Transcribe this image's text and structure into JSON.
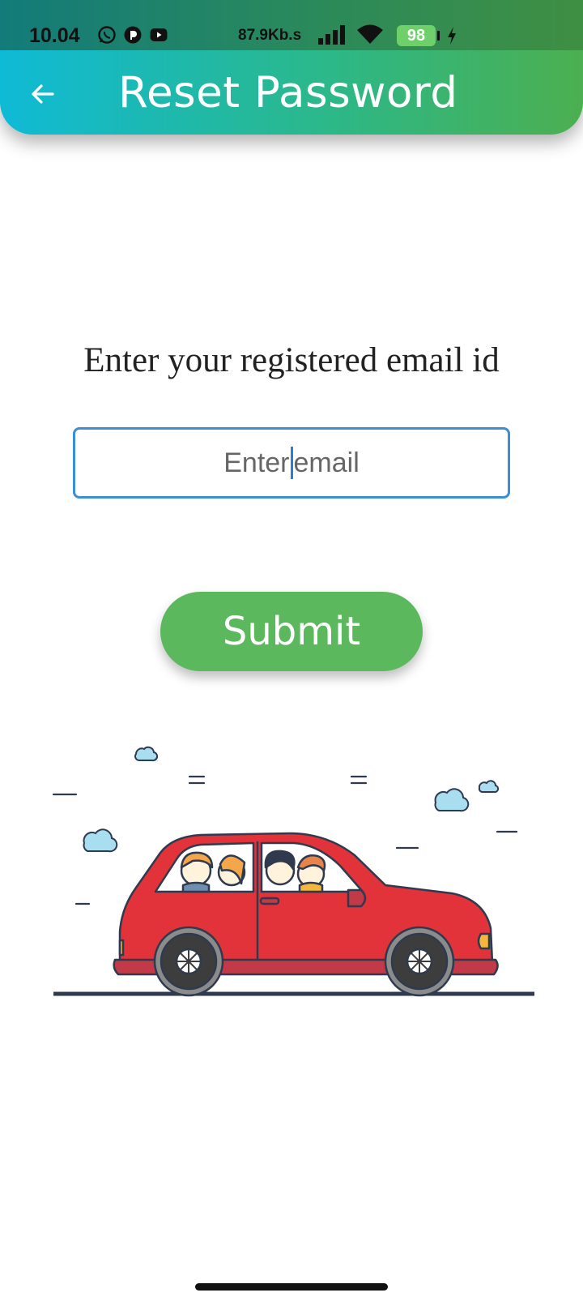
{
  "status_bar": {
    "time": "10.04",
    "network_speed": "87.9Kb.s",
    "battery": "98",
    "icons": [
      "whatsapp-icon",
      "app-icon",
      "youtube-icon",
      "signal-icon",
      "wifi-icon",
      "battery-icon",
      "charging-bolt-icon"
    ]
  },
  "header": {
    "back_icon": "back-arrow-icon",
    "title": "Reset Password"
  },
  "main": {
    "prompt": "Enter your registered email id",
    "email_input": {
      "placeholder_before_caret": "Enter",
      "placeholder_after_caret": "email",
      "value": ""
    },
    "submit_label": "Submit",
    "illustration": "car-with-passengers-illustration"
  },
  "colors": {
    "header_start": "#0fbad6",
    "header_end": "#4caf50",
    "submit_button": "#5cb85c",
    "input_border": "#3b8fd6",
    "car_body": "#e2323a"
  }
}
